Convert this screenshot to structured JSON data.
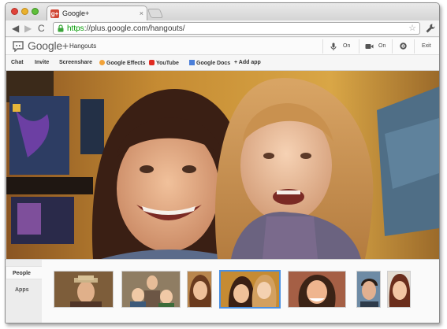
{
  "window": {
    "tab_title": "Google+",
    "tab_favicon": "g+",
    "tab_close": "×"
  },
  "toolbar": {
    "back": "◀",
    "forward": "▶",
    "reload": "C",
    "url_scheme": "https",
    "url_rest": "://plus.google.com/hangouts/",
    "star": "☆"
  },
  "gplus": {
    "brand": "Google+",
    "section": "Hangouts",
    "mic_label": "On",
    "cam_label": "On",
    "exit_label": "Exit"
  },
  "appbar": {
    "items": [
      "Chat",
      "Invite",
      "Screenshare",
      "Google Effects",
      "YouTube",
      "Google Docs",
      "+ Add app"
    ]
  },
  "sidebar": {
    "tabs": [
      "People",
      "Apps"
    ]
  },
  "colors": {
    "selected_border": "#4a90e2",
    "wall": "#c8902f",
    "https_green": "#009a00"
  }
}
